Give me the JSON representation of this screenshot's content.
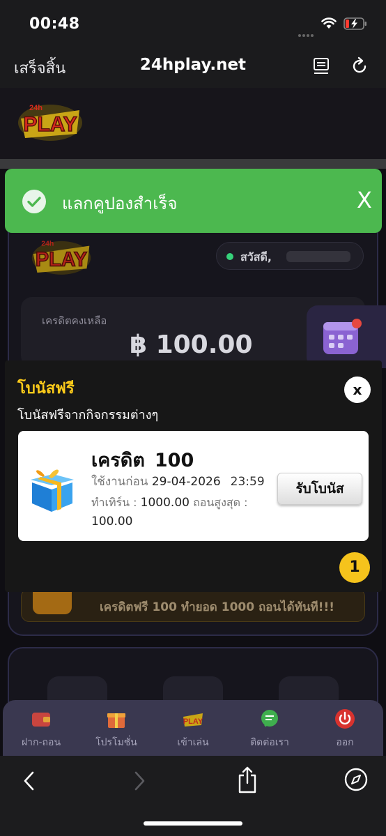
{
  "status_bar": {
    "time": "00:48"
  },
  "browser": {
    "done_label": "เสร็จสิ้น",
    "url": "24hplay.net"
  },
  "site": {
    "greeting": "สวัสดี,",
    "credit_label": "เครดิตคงเหลือ",
    "credit_amount": "฿ 100.00",
    "banner_text": "เครดิตฟรี 100 ทำยอด 1000 ถอนได้ทันที!!!",
    "nav": [
      {
        "label": "ฝาก-ถอน",
        "icon": "wallet-icon"
      },
      {
        "label": "โปรโมชั่น",
        "icon": "gift-box-icon"
      },
      {
        "label": "เข้าเล่น",
        "icon": "play-logo-icon"
      },
      {
        "label": "ติดต่อเรา",
        "icon": "chat-icon"
      },
      {
        "label": "ออก",
        "icon": "power-icon"
      }
    ]
  },
  "toast": {
    "message": "แลกคูปองสำเร็จ",
    "close_label": "X",
    "color": "#4cb84f"
  },
  "modal": {
    "title": "โบนัสฟรี",
    "subtitle": "โบนัสฟรีจากกิจกรรมต่างๆ",
    "close_label": "x",
    "page_badge": "1",
    "bonus": {
      "name": "เครดิต",
      "amount": "100",
      "use_before_label": "ใช้งานก่อน",
      "use_before_date": "29-04-2026",
      "use_before_time": "23:59",
      "turnover_label": "ทำเทิร์น :",
      "turnover_value": "1000.00",
      "max_withdraw_label": "ถอนสูงสุด :",
      "max_withdraw_value": "100.00",
      "claim_button": "รับโบนัส"
    },
    "title_color": "#ffcc1a"
  }
}
